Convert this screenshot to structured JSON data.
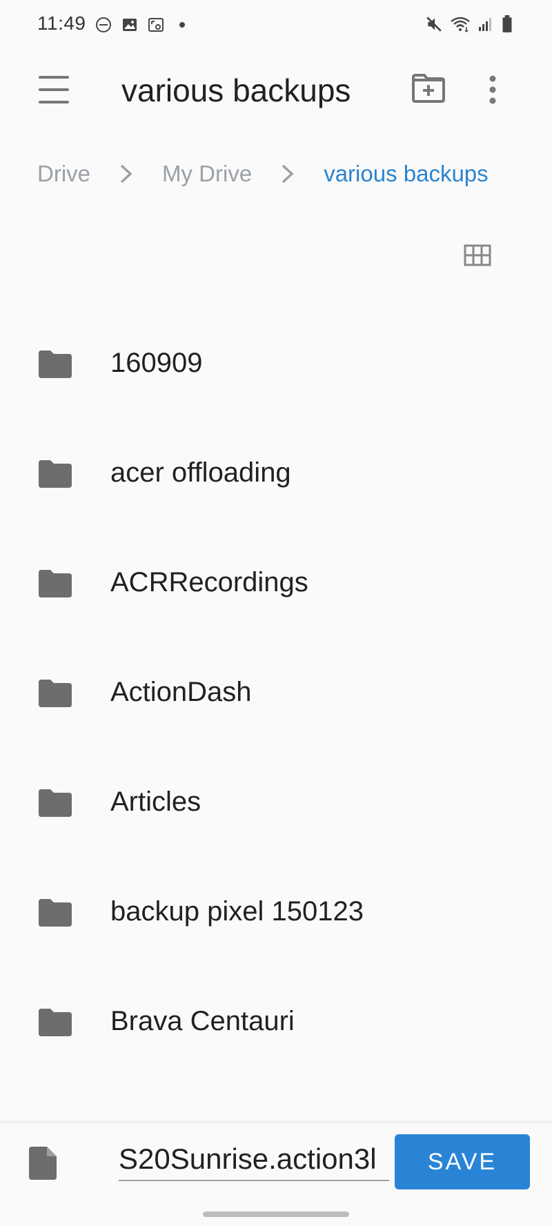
{
  "status_bar": {
    "time": "11:49",
    "left_icons": [
      "do-not-disturb-icon",
      "image-icon",
      "screenshot-icon",
      "dot-icon"
    ],
    "right_icons": [
      "mute-icon",
      "wifi-icon",
      "signal-icon",
      "battery-icon"
    ]
  },
  "app_bar": {
    "title": "various backups",
    "icons": [
      "menu-icon",
      "new-folder-icon",
      "more-vert-icon"
    ]
  },
  "breadcrumb": {
    "items": [
      "Drive",
      "My Drive",
      "various backups"
    ]
  },
  "view_toggle_icon": "grid-view-icon",
  "folders": [
    {
      "name": "160909"
    },
    {
      "name": "acer offloading"
    },
    {
      "name": "ACRRecordings"
    },
    {
      "name": "ActionDash"
    },
    {
      "name": "Articles"
    },
    {
      "name": "backup pixel 150123"
    },
    {
      "name": "Brava Centauri"
    }
  ],
  "save_bar": {
    "filename": "S20Sunrise.action3l",
    "save_label": "SAVE"
  },
  "colors": {
    "accent": "#2a84d6",
    "breadcrumb_current": "#2b84cf",
    "icon_gray": "#6d6d6d"
  }
}
